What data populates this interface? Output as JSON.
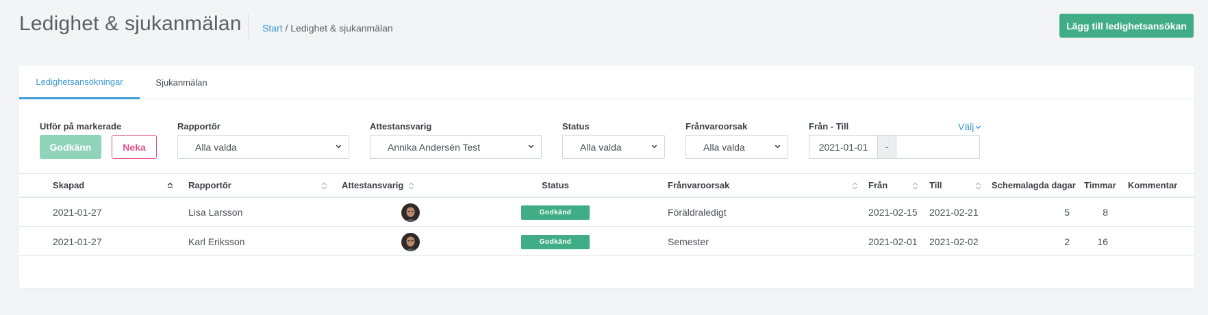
{
  "header": {
    "title": "Ledighet & sjukanmälan",
    "breadcrumb": {
      "link": "Start",
      "separator": " / ",
      "current": "Ledighet & sjukanmälan"
    },
    "primary_button": "Lägg till ledighetsansökan"
  },
  "tabs": [
    {
      "label": "Ledighetsansökningar",
      "active": true
    },
    {
      "label": "Sjukanmälan",
      "active": false
    }
  ],
  "filters": {
    "bulk": {
      "label": "Utför på markerade",
      "approve": "Godkänn",
      "deny": "Neka"
    },
    "reporter": {
      "label": "Rapportör",
      "value": "Alla valda"
    },
    "attester": {
      "label": "Attestansvarig",
      "value": "Annika Andersén Test"
    },
    "status": {
      "label": "Status",
      "value": "Alla valda"
    },
    "reason": {
      "label": "Frånvaroorsak",
      "value": "Alla valda"
    },
    "daterange": {
      "label": "Från - Till",
      "from": "2021-01-01",
      "separator": "-",
      "to": "",
      "choose": "Välj"
    }
  },
  "table": {
    "columns": {
      "created": "Skapad",
      "reporter": "Rapportör",
      "attester": "Attestansvarig",
      "status": "Status",
      "reason": "Frånvaroorsak",
      "from": "Från",
      "to": "Till",
      "days": "Schemalagda dagar",
      "hours": "Timmar",
      "comment": "Kommentar"
    },
    "rows": [
      {
        "created": "2021-01-27",
        "reporter": "Lisa Larsson",
        "status": "Godkänd",
        "reason": "Föräldraledigt",
        "from": "2021-02-15",
        "to": "2021-02-21",
        "days": "5",
        "hours": "8",
        "comment": ""
      },
      {
        "created": "2021-01-27",
        "reporter": "Karl Eriksson",
        "status": "Godkänd",
        "reason": "Semester",
        "from": "2021-02-01",
        "to": "2021-02-02",
        "days": "2",
        "hours": "16",
        "comment": ""
      }
    ]
  },
  "icons": {
    "chevron": "chevron-down-icon",
    "sort": "sort-icon",
    "sort_active": "sort-up-icon",
    "avatar": "avatar"
  },
  "colors": {
    "accent": "#3d9ad6",
    "success": "#41ad86",
    "success_light": "#8fd4b9",
    "danger": "#e8528a",
    "background": "#f3f4f6"
  }
}
